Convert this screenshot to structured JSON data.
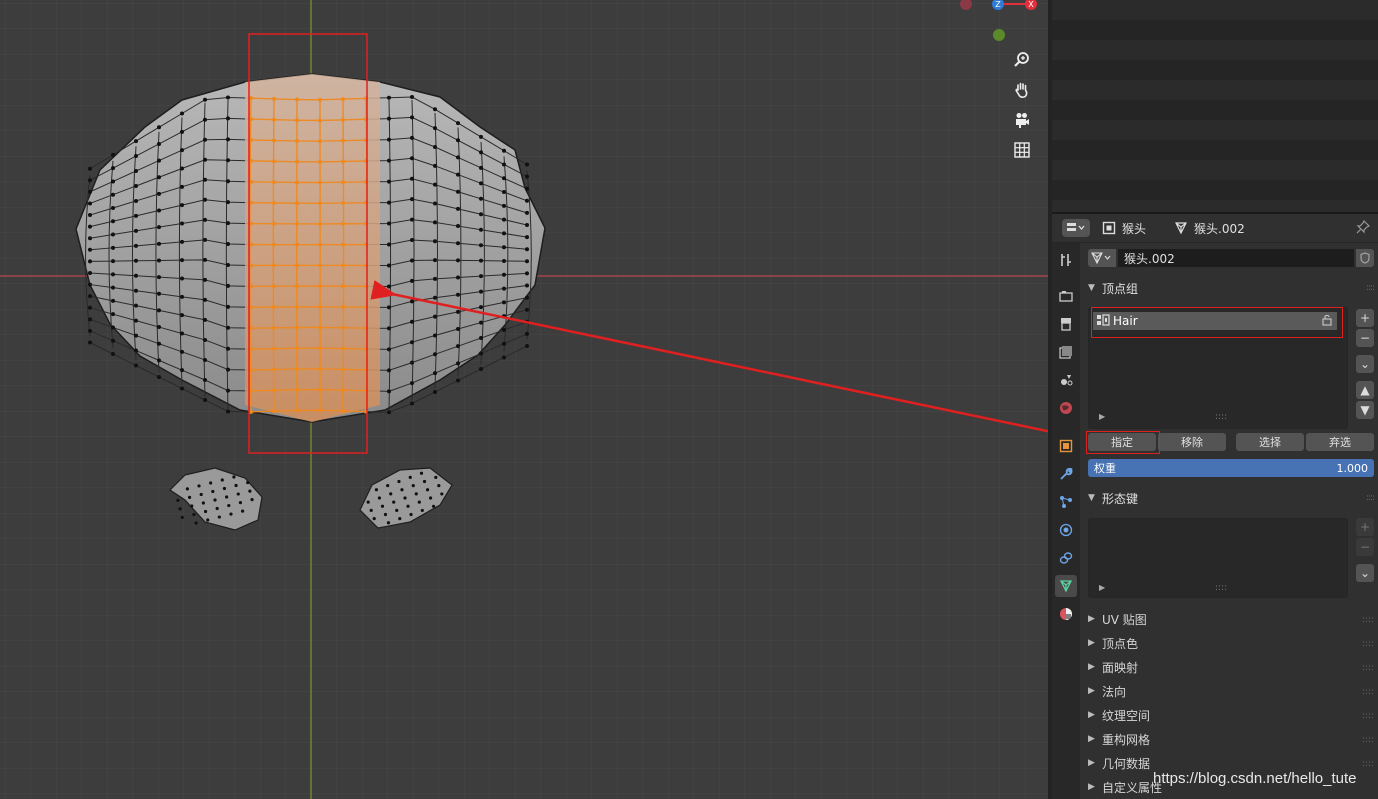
{
  "viewport": {
    "axis_z_label": "Z",
    "axis_x_label": "X",
    "nav_icons": [
      "zoom-icon",
      "pan-hand-icon",
      "camera-icon",
      "grid-toggle-icon"
    ]
  },
  "properties": {
    "header": {
      "object_name": "猴头",
      "mesh_name": "猴头.002"
    },
    "mesh_datablock": "猴头.002",
    "vertex_groups": {
      "title": "顶点组",
      "items": [
        {
          "label": "Hair"
        }
      ],
      "buttons": {
        "assign": "指定",
        "remove": "移除",
        "select": "选择",
        "deselect": "弃选"
      },
      "weight_label": "权重",
      "weight_value": "1.000"
    },
    "shape_keys": {
      "title": "形态键"
    },
    "collapsed_panels": [
      {
        "label": "UV 贴图"
      },
      {
        "label": "顶点色"
      },
      {
        "label": "面映射"
      },
      {
        "label": "法向"
      },
      {
        "label": "纹理空间"
      },
      {
        "label": "重构网格"
      },
      {
        "label": "几何数据"
      },
      {
        "label": "自定义属性"
      }
    ]
  },
  "watermark": "https://blog.csdn.net/hello_tute",
  "colors": {
    "selection_orange": "#f0891e",
    "annotation_red": "#e02020",
    "weight_blue": "#4772b3",
    "active_tab_green": "#5bd1a0"
  }
}
